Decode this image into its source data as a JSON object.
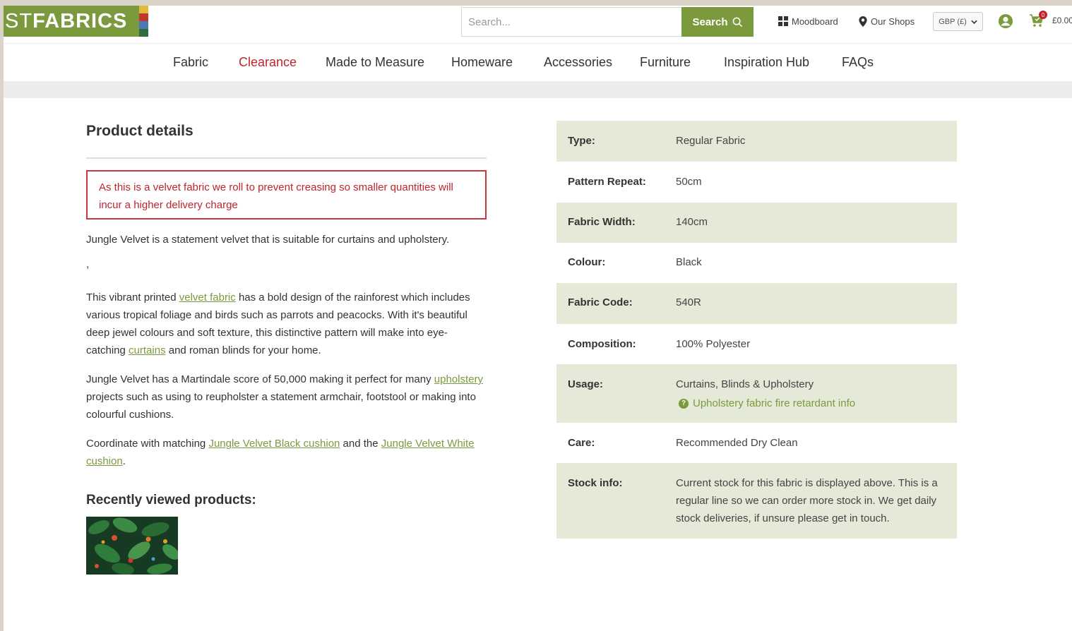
{
  "header": {
    "logo": {
      "light": "ST",
      "bold": "FABRICS"
    },
    "logo_colors": [
      "#e2b93b",
      "#c0392b",
      "#4b7bb5",
      "#7b9a3d"
    ],
    "search": {
      "placeholder": "Search...",
      "button_label": "Search",
      "icon": "search-icon"
    },
    "moodboard_label": "Moodboard",
    "shops_label": "Our Shops",
    "currency": "GBP (£)",
    "cart": {
      "badge": "0",
      "total": "£0.00"
    },
    "accent_color": "#7b9a3d"
  },
  "nav": {
    "items": [
      {
        "label": "Fabric"
      },
      {
        "label": "Clearance",
        "active": true
      },
      {
        "label": "Made to Measure"
      },
      {
        "label": "Homeware"
      },
      {
        "label": "Accessories"
      },
      {
        "label": "Furniture"
      },
      {
        "label": "Inspiration Hub"
      },
      {
        "label": "FAQs"
      }
    ],
    "active_color": "#c0252f"
  },
  "details": {
    "title": "Product details",
    "notice": "As this is a velvet fabric we roll to prevent creasing so smaller quantities will incur a higher delivery charge",
    "intro": "Jungle Velvet is a statement velvet that is suitable for curtains and upholstery.",
    "comma": ",",
    "p1": {
      "a": "This vibrant printed ",
      "link1": "velvet fabric",
      "b": " has a bold design of the rainforest which includes various tropical foliage and birds such as parrots and peacocks. With it's beautiful deep jewel colours and soft texture, this distinctive pattern will make into eye-catching ",
      "link2": "curtains",
      "c": " and roman blinds for your home."
    },
    "p2": {
      "a": "Jungle Velvet has a Martindale score of 50,000 making it perfect for many ",
      "link1": "upholstery",
      "b": " projects such as using to reupholster a statement armchair, footstool or making into colourful cushions."
    },
    "p3": {
      "a": "Coordinate with matching ",
      "link1": "Jungle Velvet Black cushion",
      "b": " and the ",
      "link2": "Jungle Velvet White cushion",
      "c": "."
    },
    "recent_title": "Recently viewed products:"
  },
  "specs": {
    "rows": [
      {
        "label": "Type:",
        "value": "Regular Fabric"
      },
      {
        "label": "Pattern Repeat:",
        "value": "50cm"
      },
      {
        "label": "Fabric Width:",
        "value": "140cm"
      },
      {
        "label": "Colour:",
        "value": "Black"
      },
      {
        "label": "Fabric Code:",
        "value": "540R"
      },
      {
        "label": "Composition:",
        "value": "100% Polyester"
      },
      {
        "label": "Usage:",
        "value": "Curtains, Blinds & Upholstery",
        "link": "Upholstery fabric fire retardant info"
      },
      {
        "label": "Care:",
        "value": "Recommended Dry Clean"
      },
      {
        "label": "Stock info:",
        "value": "Current stock for this fabric is displayed above. This is a regular line so we can order more stock in. We get daily stock deliveries, if unsure please get in touch."
      }
    ],
    "shade_color": "#e5e9d8"
  }
}
